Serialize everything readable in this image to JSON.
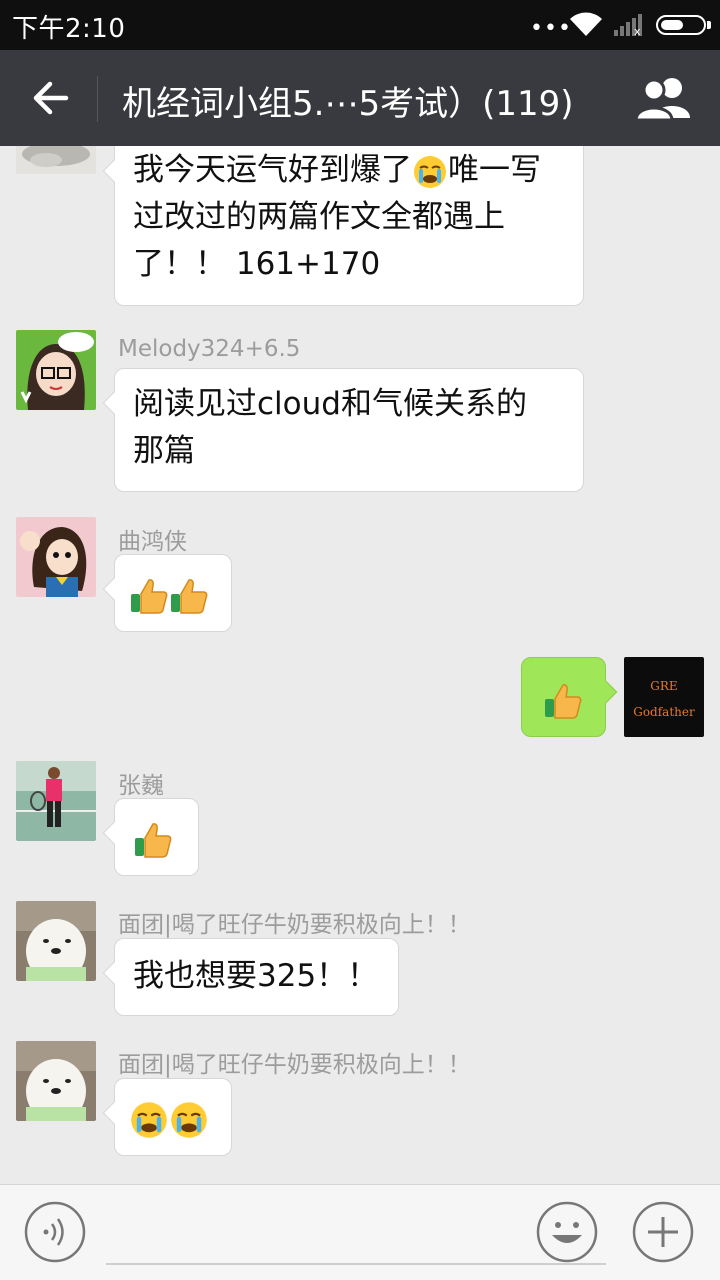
{
  "status_bar": {
    "time": "下午2:10",
    "dots": "•••"
  },
  "header": {
    "title": "机经词小组5.⋯5考试）(119)"
  },
  "messages": [
    {
      "sender": "",
      "text_1": "我今天运气好到爆了",
      "text_2": "唯一写",
      "text_3": "过改过的两篇作文全都遇上",
      "text_4": "了！！ 161+170"
    },
    {
      "sender": "Melody324+6.5",
      "text_1": "阅读见过cloud和气候关系的",
      "text_2": "那篇"
    },
    {
      "sender": "曲鸿侠",
      "emoji": "thumbs-up x2"
    },
    {
      "sender": "",
      "emoji": "thumbs-up",
      "mine": true,
      "avatar_text_1": "GRE",
      "avatar_text_2": "Godfather"
    },
    {
      "sender": "张巍",
      "emoji": "thumbs-up"
    },
    {
      "sender": "面团|喝了旺仔牛奶要积极向上！！",
      "text_1": "我也想要325！！"
    },
    {
      "sender": "面团|喝了旺仔牛奶要积极向上！！",
      "emoji": "crying x2"
    }
  ],
  "colors": {
    "header_bg": "#393a3f",
    "chat_bg": "#ebebeb",
    "my_bubble": "#9fe658",
    "other_bubble": "#ffffff"
  }
}
